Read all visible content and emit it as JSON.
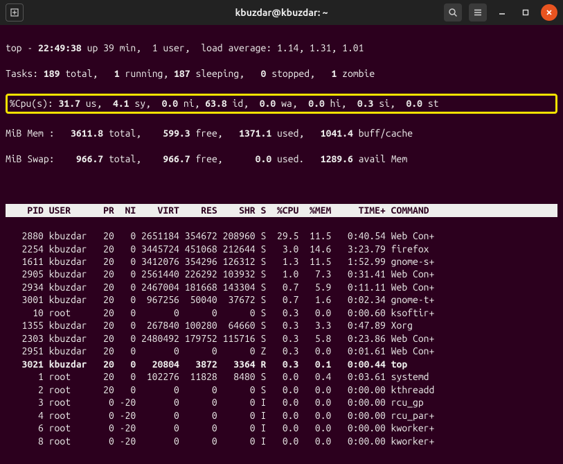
{
  "window": {
    "title": "kbuzdar@kbuzdar: ~"
  },
  "summary": {
    "line1_a": "top - ",
    "line1_time": "22:49:38",
    "line1_b": " up 39 min,  1 user,  load average: 1.14, 1.31, 1.01",
    "tasks_a": "Tasks: ",
    "tasks_total": "189",
    "tasks_b": " total,   ",
    "tasks_run": "1",
    "tasks_c": " running, ",
    "tasks_sleep": "187",
    "tasks_d": " sleeping,   ",
    "tasks_stop": "0",
    "tasks_e": " stopped,   ",
    "tasks_zomb": "1",
    "tasks_f": " zombie",
    "cpu_a": "%Cpu(s): ",
    "cpu_us": "31.7",
    "cpu_b": " us,  ",
    "cpu_sy": "4.1",
    "cpu_c": " sy,  ",
    "cpu_ni": "0.0",
    "cpu_d": " ni, ",
    "cpu_id": "63.8",
    "cpu_e": " id,  ",
    "cpu_wa": "0.0",
    "cpu_f": " wa,  ",
    "cpu_hi": "0.0",
    "cpu_g": " hi,  ",
    "cpu_si": "0.3",
    "cpu_h": " si,  ",
    "cpu_st": "0.0",
    "cpu_i": " st",
    "mem_a": "MiB Mem :   ",
    "mem_total": "3611.8",
    "mem_b": " total,    ",
    "mem_free": "599.3",
    "mem_c": " free,   ",
    "mem_used": "1371.1",
    "mem_d": " used,   ",
    "mem_buff": "1041.4",
    "mem_e": " buff/cache",
    "swap_a": "MiB Swap:    ",
    "swap_total": "966.7",
    "swap_b": " total,    ",
    "swap_free": "966.7",
    "swap_c": " free,      ",
    "swap_used": "0.0",
    "swap_d": " used.   ",
    "swap_avail": "1289.6",
    "swap_e": " avail Mem"
  },
  "header": "    PID USER      PR  NI    VIRT    RES    SHR S  %CPU  %MEM     TIME+ COMMAND ",
  "rows": [
    {
      "l": "   2880 kbuzdar   20   0 2651184 354672 208960 S  29.5  11.5   0:40.54 Web Con+",
      "r": false
    },
    {
      "l": "   2254 kbuzdar   20   0 3445724 451068 212644 S   3.0  14.6   3:23.79 firefox",
      "r": false
    },
    {
      "l": "   1611 kbuzdar   20   0 3412076 354296 126312 S   1.3  11.5   1:52.99 gnome-s+",
      "r": false
    },
    {
      "l": "   2905 kbuzdar   20   0 2561440 226292 103932 S   1.0   7.3   0:31.41 Web Con+",
      "r": false
    },
    {
      "l": "   2934 kbuzdar   20   0 2467004 181668 143304 S   0.7   5.9   0:11.11 Web Con+",
      "r": false
    },
    {
      "l": "   3001 kbuzdar   20   0  967256  50040  37672 S   0.7   1.6   0:02.34 gnome-t+",
      "r": false
    },
    {
      "l": "     10 root      20   0       0      0      0 S   0.3   0.0   0:00.60 ksoftir+",
      "r": false
    },
    {
      "l": "   1355 kbuzdar   20   0  267840 100280  64660 S   0.3   3.3   0:47.89 Xorg",
      "r": false
    },
    {
      "l": "   2303 kbuzdar   20   0 2480492 179752 115716 S   0.3   5.8   0:23.86 Web Con+",
      "r": false
    },
    {
      "l": "   2951 kbuzdar   20   0       0      0      0 Z   0.3   0.0   0:01.61 Web Con+",
      "r": false
    },
    {
      "l": "   3021 kbuzdar   20   0   20804   3872   3364 R   0.3   0.1   0:00.44 top",
      "r": true
    },
    {
      "l": "      1 root      20   0  102276  11828   8480 S   0.0   0.4   0:03.61 systemd",
      "r": false
    },
    {
      "l": "      2 root      20   0       0      0      0 S   0.0   0.0   0:00.00 kthreadd",
      "r": false
    },
    {
      "l": "      3 root       0 -20       0      0      0 I   0.0   0.0   0:00.00 rcu_gp",
      "r": false
    },
    {
      "l": "      4 root       0 -20       0      0      0 I   0.0   0.0   0:00.00 rcu_par+",
      "r": false
    },
    {
      "l": "      6 root       0 -20       0      0      0 I   0.0   0.0   0:00.00 kworker+",
      "r": false
    },
    {
      "l": "      8 root       0 -20       0      0      0 I   0.0   0.0   0:00.00 kworker+",
      "r": false
    }
  ]
}
